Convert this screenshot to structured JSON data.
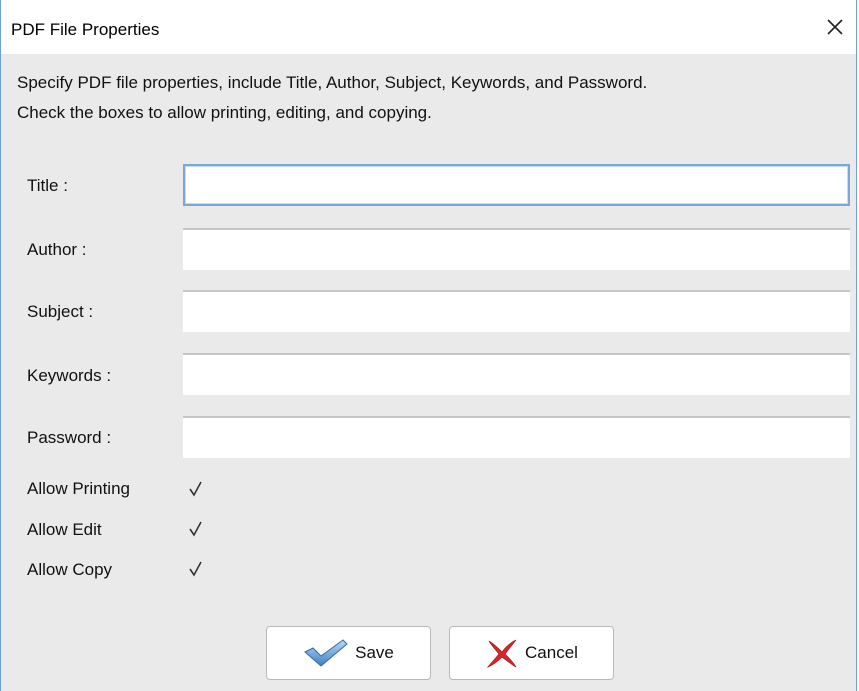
{
  "window": {
    "title": "PDF File Properties"
  },
  "description": {
    "line1": "Specify PDF file properties, include Title, Author, Subject, Keywords, and Password.",
    "line2": "Check the boxes to allow printing, editing, and copying."
  },
  "fields": [
    {
      "label": "Title :",
      "value": ""
    },
    {
      "label": "Author :",
      "value": ""
    },
    {
      "label": "Subject :",
      "value": ""
    },
    {
      "label": "Keywords :",
      "value": ""
    },
    {
      "label": "Password :",
      "value": ""
    }
  ],
  "checkboxes": [
    {
      "label": "Allow Printing",
      "checked": true
    },
    {
      "label": "Allow Edit",
      "checked": true
    },
    {
      "label": "Allow Copy",
      "checked": true
    }
  ],
  "buttons": {
    "save": "Save",
    "cancel": "Cancel"
  },
  "colors": {
    "dialog_bg": "#eaeaea",
    "focus_border": "#7aa7d6",
    "save_icon": "#3f7fc4",
    "cancel_icon": "#d9262b"
  },
  "icons": {
    "close": "close-icon",
    "check": "checkmark-icon",
    "save": "save-check-icon",
    "cancel": "cancel-x-icon"
  }
}
